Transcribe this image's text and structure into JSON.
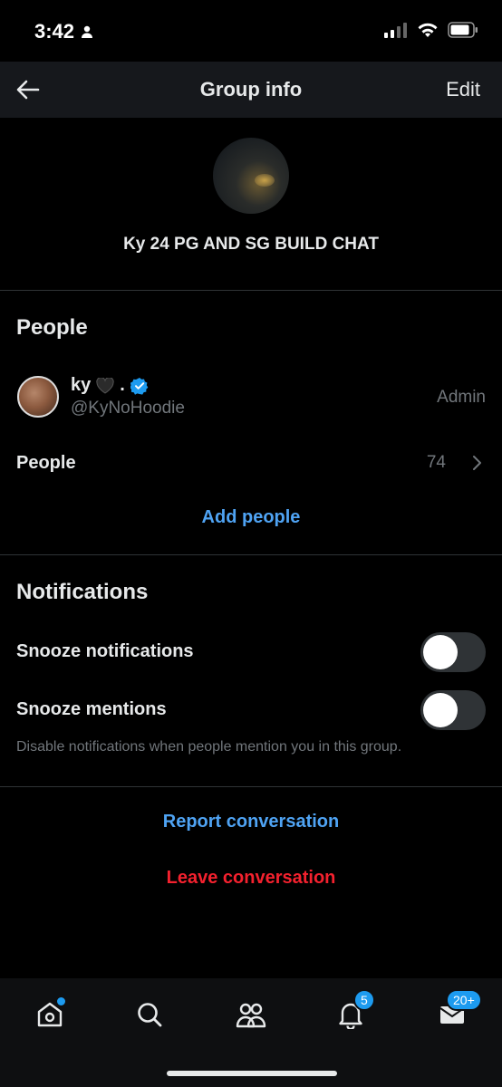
{
  "status_bar": {
    "time": "3:42"
  },
  "header": {
    "title": "Group info",
    "edit_label": "Edit"
  },
  "group": {
    "name": "Ky 24 PG AND SG BUILD CHAT"
  },
  "people_section": {
    "title": "People",
    "member": {
      "name": "ky",
      "suffix": ".",
      "handle": "@KyNoHoodie",
      "role": "Admin",
      "verified": true
    },
    "people_row": {
      "label": "People",
      "count": "74"
    },
    "add_label": "Add people"
  },
  "notifications_section": {
    "title": "Notifications",
    "snooze_notifications": {
      "label": "Snooze notifications",
      "on": false
    },
    "snooze_mentions": {
      "label": "Snooze mentions",
      "on": false
    },
    "hint": "Disable notifications when people mention you in this group."
  },
  "actions": {
    "report_label": "Report conversation",
    "leave_label": "Leave conversation"
  },
  "tabbar": {
    "notifications_badge": "5",
    "messages_badge": "20+"
  },
  "colors": {
    "accent": "#4fa3f3",
    "danger": "#f4212e",
    "muted": "#71767b"
  }
}
